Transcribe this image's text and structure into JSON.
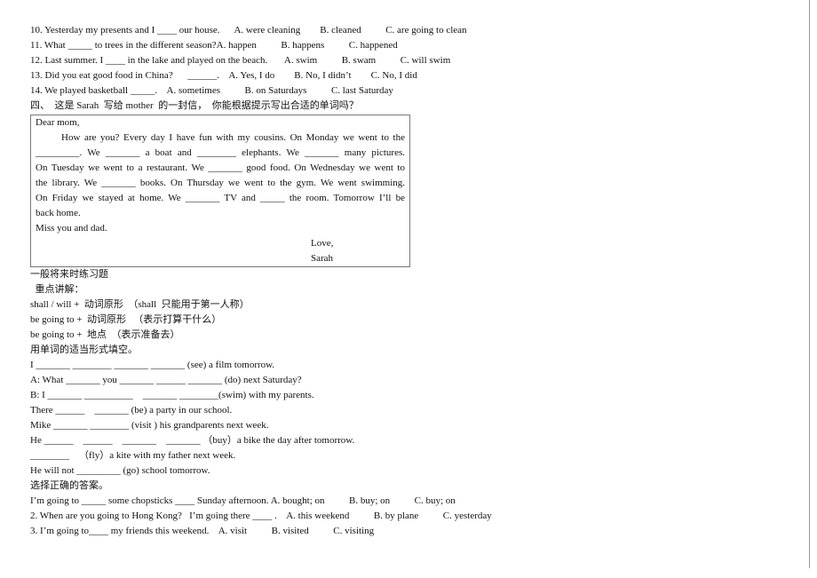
{
  "questions_top": [
    "10. Yesterday my presents and I ____ our house.      A. were cleaning        B. cleaned          C. are going to clean",
    "11. What _____ to trees in the different season?A. happen          B. happens          C. happened",
    "12. Last summer. I ____ in the lake and played on the beach.       A. swim          B. swam          C. will swim",
    "13. Did you eat good food in China?      ______.    A. Yes, I do        B. No, I didn’t        C. No, I did",
    "14. We played basketball _____.    A. sometimes          B. on Saturdays          C. last Saturday",
    "四、  这是 Sarah  写给 mother  的一封信，  你能根据提示写出合适的单词吗？"
  ],
  "letter": {
    "greeting": "Dear mom,",
    "lines": [
      "How are you? Every day I have fun with my cousins. On Monday we went to the",
      "_________. We _______ a boat and ________ elephants. We _______ many pictures.",
      "On Tuesday we went to a restaurant. We _______ good food. On Wednesday we went to",
      "the library. We _______ books. On Thursday we went to the gym. We went swimming.",
      "On Friday we stayed at home. We _______ TV and _____ the room. Tomorrow I’ll be"
    ],
    "last_line": "back home.",
    "closing": "Miss you and dad.",
    "love": "Love,",
    "signature": "Sarah"
  },
  "section_future": [
    "一般将来时练习题",
    "  重点讲解：",
    "shall / will +  动词原形  （shall  只能用于第一人称）",
    "be going to +  动词原形   （表示打算干什么）",
    "be going to +  地点  （表示准备去）",
    "用单词的适当形式填空。",
    "I _______ ________ _______ _______ (see) a film tomorrow.",
    "A: What _______ you _______ ______ _______ (do) next Saturday?",
    "B: I _______ __________    _______ ________(swim) with my parents.",
    "There ______    _______ (be) a party in our school.",
    "Mike _______ ________ (visit ) his grandparents next week.",
    "He ______    ______    _______    _______ （buy）a bike the day after tomorrow.",
    "________    （fly）a kite with my father next week.",
    "He will not _________ (go) school tomorrow.",
    "选择正确的答案。",
    "I’m going to _____ some chopsticks ____ Sunday afternoon. A. bought; on          B. buy; on          C. buy; on",
    "2. When are you going to Hong Kong?   I’m going there ____ .    A. this weekend          B. by plane          C. yesterday",
    "3. I’m going to____ my friends this weekend.    A. visit          B. visited          C. visiting"
  ]
}
